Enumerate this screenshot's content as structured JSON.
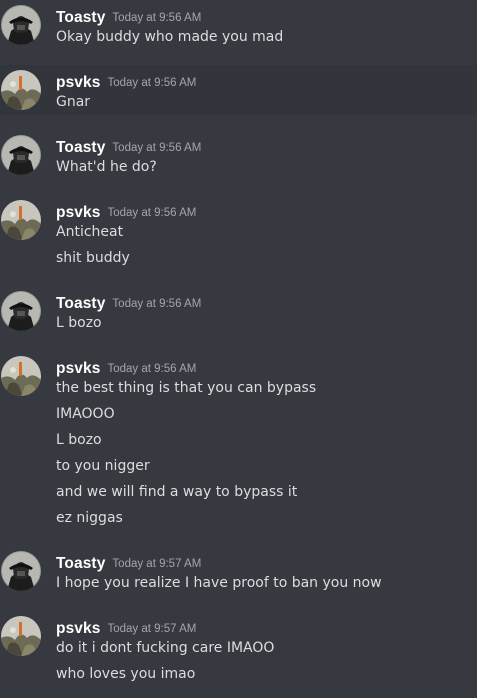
{
  "messages": [
    {
      "author": "Toasty",
      "time": "Today at 9:56 AM",
      "lines": [
        "Okay buddy who made you mad"
      ]
    },
    {
      "author": "psvks",
      "time": "Today at 9:56 AM",
      "lines": [
        "Gnar"
      ]
    },
    {
      "author": "Toasty",
      "time": "Today at 9:56 AM",
      "lines": [
        "What'd he do?"
      ]
    },
    {
      "author": "psvks",
      "time": "Today at 9:56 AM",
      "lines": [
        "Anticheat",
        "shit buddy"
      ]
    },
    {
      "author": "Toasty",
      "time": "Today at 9:56 AM",
      "lines": [
        "L bozo"
      ]
    },
    {
      "author": "psvks",
      "time": "Today at 9:56 AM",
      "lines": [
        "the best thing is that you can bypass",
        "IMAOOO",
        "L bozo",
        "to you nigger",
        "and we will find a way to bypass it",
        "ez niggas"
      ]
    },
    {
      "author": "Toasty",
      "time": "Today at 9:57 AM",
      "lines": [
        "I hope you realize I have proof to ban you now"
      ]
    },
    {
      "author": "psvks",
      "time": "Today at 9:57 AM",
      "lines": [
        "do it i dont fucking care IMAOO",
        "who loves you imao"
      ]
    }
  ],
  "colors": {
    "background": "#36393f",
    "hover_background": "#32353b",
    "username": "#ffffff",
    "timestamp": "#a3a6aa",
    "message_text": "#dcddde"
  },
  "avatars": {
    "Toasty": "toasty-avatar-icon",
    "psvks": "psvks-avatar-icon"
  }
}
